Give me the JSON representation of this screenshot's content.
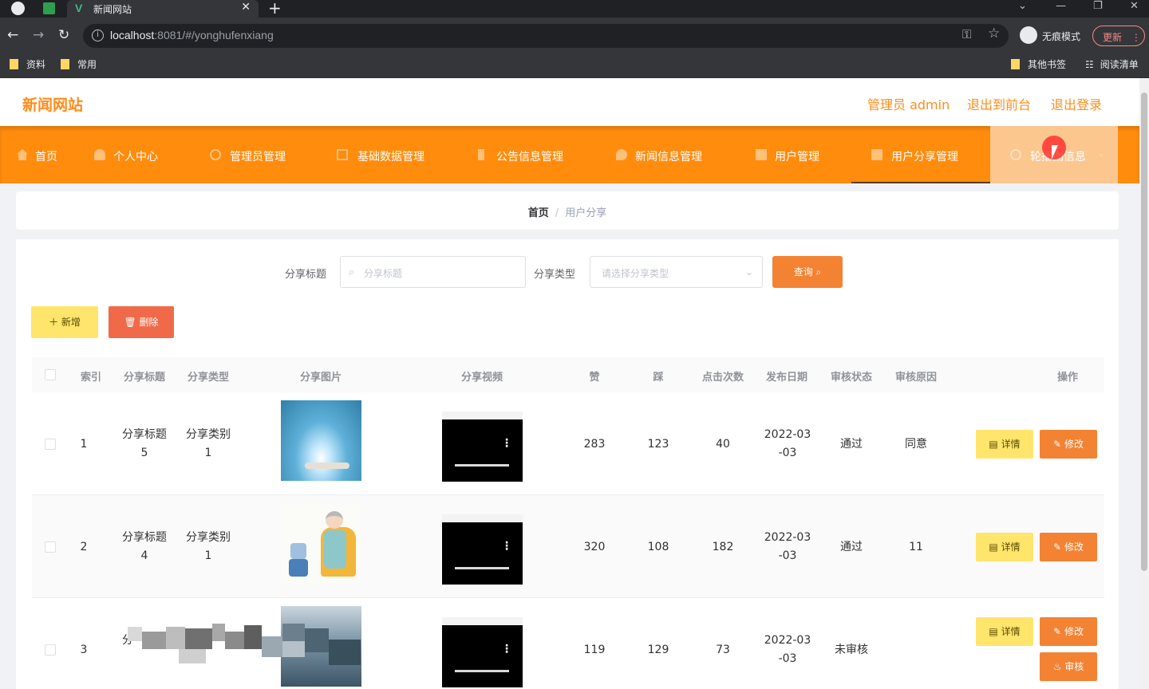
{
  "browser": {
    "tab_title": "新闻网站",
    "url_host": "localhost",
    "url_rest": ":8081/#/yonghufenxiang",
    "incognito_label": "无痕模式",
    "update_label": "更新",
    "bookmarks": [
      "资料",
      "常用"
    ],
    "other_bookmarks": "其他书签",
    "reading_list": "阅读清单"
  },
  "header": {
    "logo": "新闻网站",
    "user_label": "管理员 admin",
    "exit_front": "退出到前台",
    "logout": "退出登录"
  },
  "nav": {
    "items": [
      {
        "label": "首页"
      },
      {
        "label": "个人中心"
      },
      {
        "label": "管理员管理"
      },
      {
        "label": "基础数据管理"
      },
      {
        "label": "公告信息管理"
      },
      {
        "label": "新闻信息管理"
      },
      {
        "label": "用户管理"
      },
      {
        "label": "用户分享管理"
      },
      {
        "label": "轮播图信息"
      }
    ]
  },
  "breadcrumb": {
    "home": "首页",
    "current": "用户分享"
  },
  "search": {
    "title_label": "分享标题",
    "title_placeholder": "分享标题",
    "type_label": "分享类型",
    "type_placeholder": "请选择分享类型",
    "query_label": "查询"
  },
  "actions": {
    "add_label": "新增",
    "delete_label": "删除"
  },
  "table": {
    "columns": [
      "索引",
      "分享标题",
      "分享类型",
      "分享图片",
      "分享视频",
      "赞",
      "踩",
      "点击次数",
      "发布日期",
      "审核状态",
      "审核原因",
      "操作"
    ],
    "rows": [
      {
        "index": "1",
        "title_a": "分享标题",
        "title_b": "5",
        "type_a": "分享类别",
        "type_b": "1",
        "likes": "283",
        "dislikes": "123",
        "clicks": "40",
        "date_a": "2022-03",
        "date_b": "-03",
        "status": "通过",
        "reason": "同意",
        "image": "tablet-hologram"
      },
      {
        "index": "2",
        "title_a": "分享标题",
        "title_b": "4",
        "type_a": "分享类别",
        "type_b": "1",
        "likes": "320",
        "dislikes": "108",
        "clicks": "182",
        "date_a": "2022-03",
        "date_b": "-03",
        "status": "通过",
        "reason": "11",
        "image": "robot-grandma"
      },
      {
        "index": "3",
        "title_a": "分",
        "title_b": "",
        "type_a": "",
        "type_b": "",
        "likes": "119",
        "dislikes": "129",
        "clicks": "73",
        "date_a": "2022-03",
        "date_b": "-03",
        "status": "未审核",
        "reason": "",
        "image": "pixelated"
      }
    ],
    "detail_label": "详情",
    "edit_label": "修改",
    "audit_label": "审核"
  },
  "colors": {
    "brand": "#ff8c1a",
    "nav_bg": "#ff8c0d",
    "nav_hover": "#fbc78f",
    "yellow_btn": "#ffe56b",
    "orange_btn": "#f38233",
    "red_btn": "#f06a4a"
  }
}
